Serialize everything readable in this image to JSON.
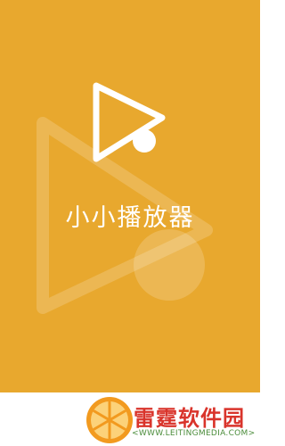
{
  "app": {
    "name": "小小播放器"
  },
  "watermark": {
    "title": "雷霆软件园",
    "url": "<WWW.LEITINGMEDIA.COM>"
  },
  "colors": {
    "background": "#E8A82E",
    "logo_stroke": "#FFFFFF",
    "watermark_red": "#D9342B",
    "watermark_orange": "#F29A1F",
    "watermark_url": "#4A8C3A"
  },
  "icons": {
    "app_logo": "play-triangle-with-dot-icon",
    "background_logo": "large-faded-play-triangle-icon",
    "watermark_logo": "orange-slice-icon"
  }
}
